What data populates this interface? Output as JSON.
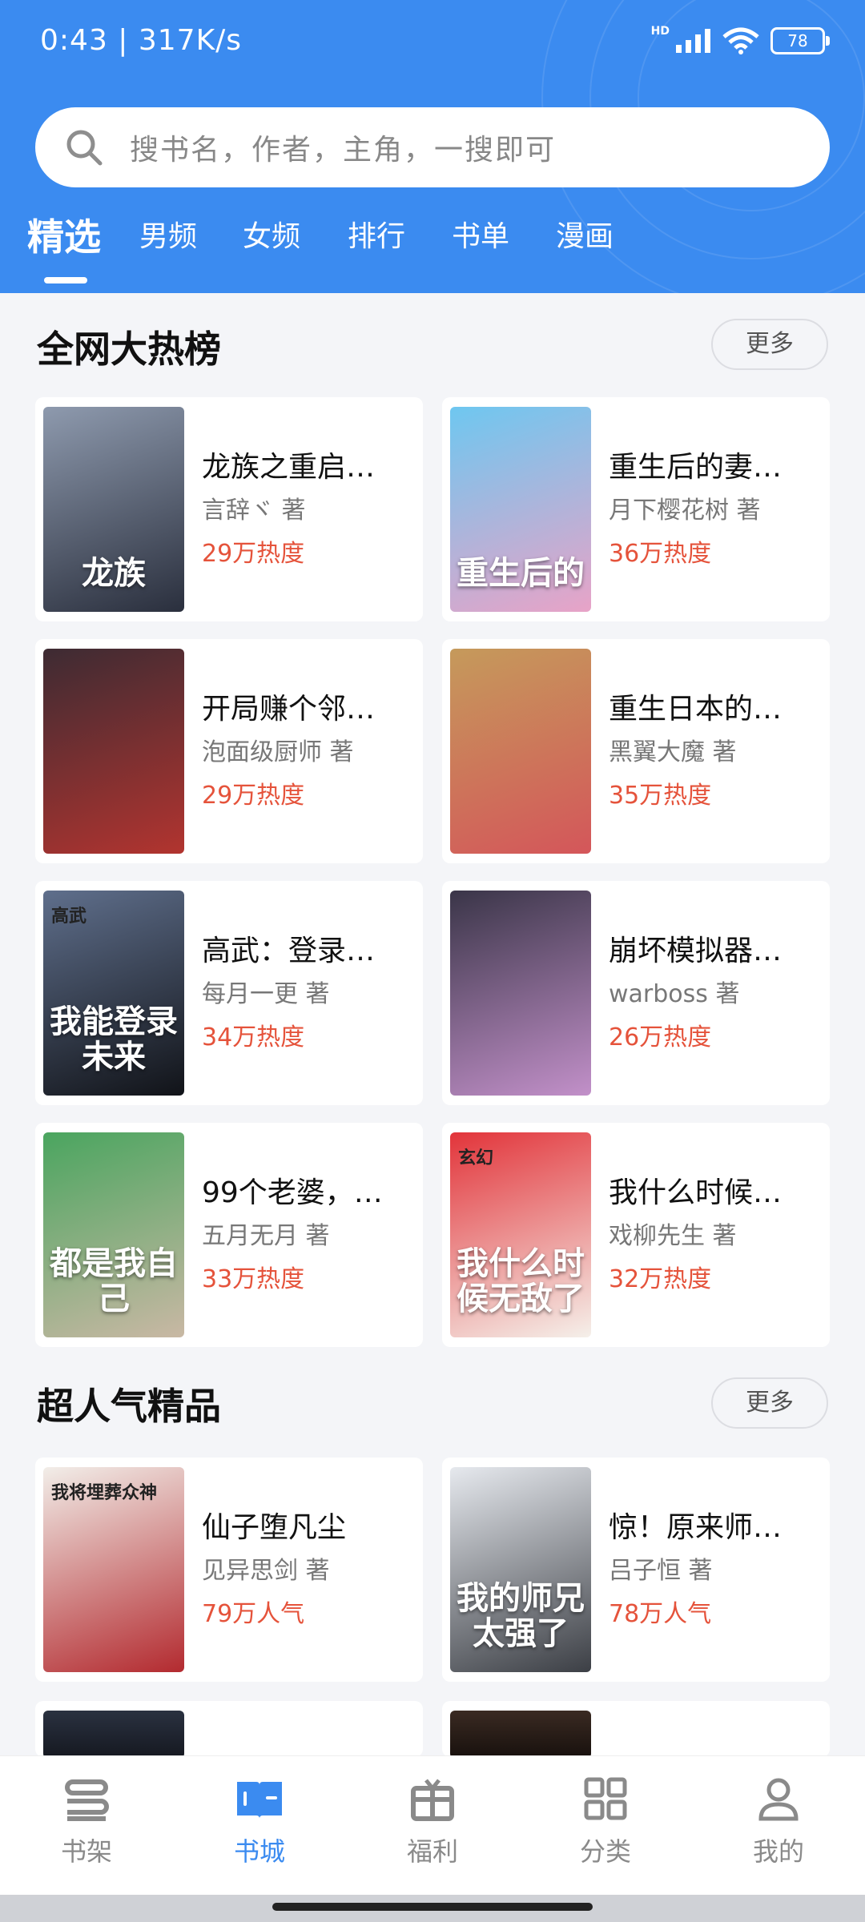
{
  "status_bar": {
    "time": "0:43 | 317K/s",
    "network": "HD",
    "battery": "78"
  },
  "search": {
    "placeholder": "搜书名，作者，主角，一搜即可"
  },
  "tabs": [
    {
      "label": "精选",
      "active": true
    },
    {
      "label": "男频"
    },
    {
      "label": "女频"
    },
    {
      "label": "排行"
    },
    {
      "label": "书单"
    },
    {
      "label": "漫画"
    }
  ],
  "sections": [
    {
      "title": "全网大热榜",
      "more_label": "更多",
      "books": [
        {
          "title": "龙族之重启…",
          "author": "言辞ヾ 著",
          "heat": "29万热度",
          "cover_text": "龙族",
          "cover_colors": [
            "#8e9aae",
            "#2a2f3d"
          ]
        },
        {
          "title": "重生后的妻…",
          "author": "月下樱花树 著",
          "heat": "36万热度",
          "cover_text": "重生后的",
          "cover_colors": [
            "#6ec7f0",
            "#e8a3c7"
          ]
        },
        {
          "title": "开局赚个邻…",
          "author": "泡面级厨师 著",
          "heat": "29万热度",
          "cover_text": "",
          "cover_colors": [
            "#3d2b33",
            "#b2342f"
          ]
        },
        {
          "title": "重生日本的…",
          "author": "黑翼大魔 著",
          "heat": "35万热度",
          "cover_text": "",
          "cover_colors": [
            "#c59a5b",
            "#d4565a"
          ]
        },
        {
          "title": "高武：登录…",
          "author": "每月一更 著",
          "heat": "34万热度",
          "cover_text": "我能登录未来",
          "cover_tag": "高武",
          "cover_colors": [
            "#5f6f8c",
            "#111318"
          ]
        },
        {
          "title": "崩坏模拟器…",
          "author": "warboss 著",
          "heat": "26万热度",
          "cover_text": "",
          "cover_colors": [
            "#3a3548",
            "#c290c9"
          ]
        },
        {
          "title": "99个老婆，…",
          "author": "五月无月 著",
          "heat": "33万热度",
          "cover_text": "都是我自己",
          "cover_colors": [
            "#4aa55f",
            "#c9b8a4"
          ]
        },
        {
          "title": "我什么时候…",
          "author": "戏柳先生 著",
          "heat": "32万热度",
          "cover_text": "我什么时候无敌了",
          "cover_tag": "玄幻",
          "cover_colors": [
            "#e2343a",
            "#f5f0ea"
          ]
        }
      ]
    },
    {
      "title": "超人气精品",
      "more_label": "更多",
      "books": [
        {
          "title": "仙子堕凡尘",
          "author": "见异思剑 著",
          "heat": "79万人气",
          "cover_text": "",
          "cover_tag": "我将埋葬众神",
          "cover_colors": [
            "#f2eee9",
            "#b32a2f"
          ]
        },
        {
          "title": "惊！原来师…",
          "author": "吕子恒 著",
          "heat": "78万人气",
          "cover_text": "我的师兄太强了",
          "cover_colors": [
            "#e6e9ee",
            "#3c3f45"
          ]
        }
      ]
    }
  ],
  "bottom_nav": [
    {
      "label": "书架",
      "icon": "bookshelf-icon"
    },
    {
      "label": "书城",
      "icon": "open-book-icon",
      "active": true
    },
    {
      "label": "福利",
      "icon": "gift-icon"
    },
    {
      "label": "分类",
      "icon": "category-grid-icon"
    },
    {
      "label": "我的",
      "icon": "user-icon"
    }
  ],
  "colors": {
    "primary": "#3b8bf0",
    "heat": "#e5533b",
    "background": "#f4f5f8"
  }
}
